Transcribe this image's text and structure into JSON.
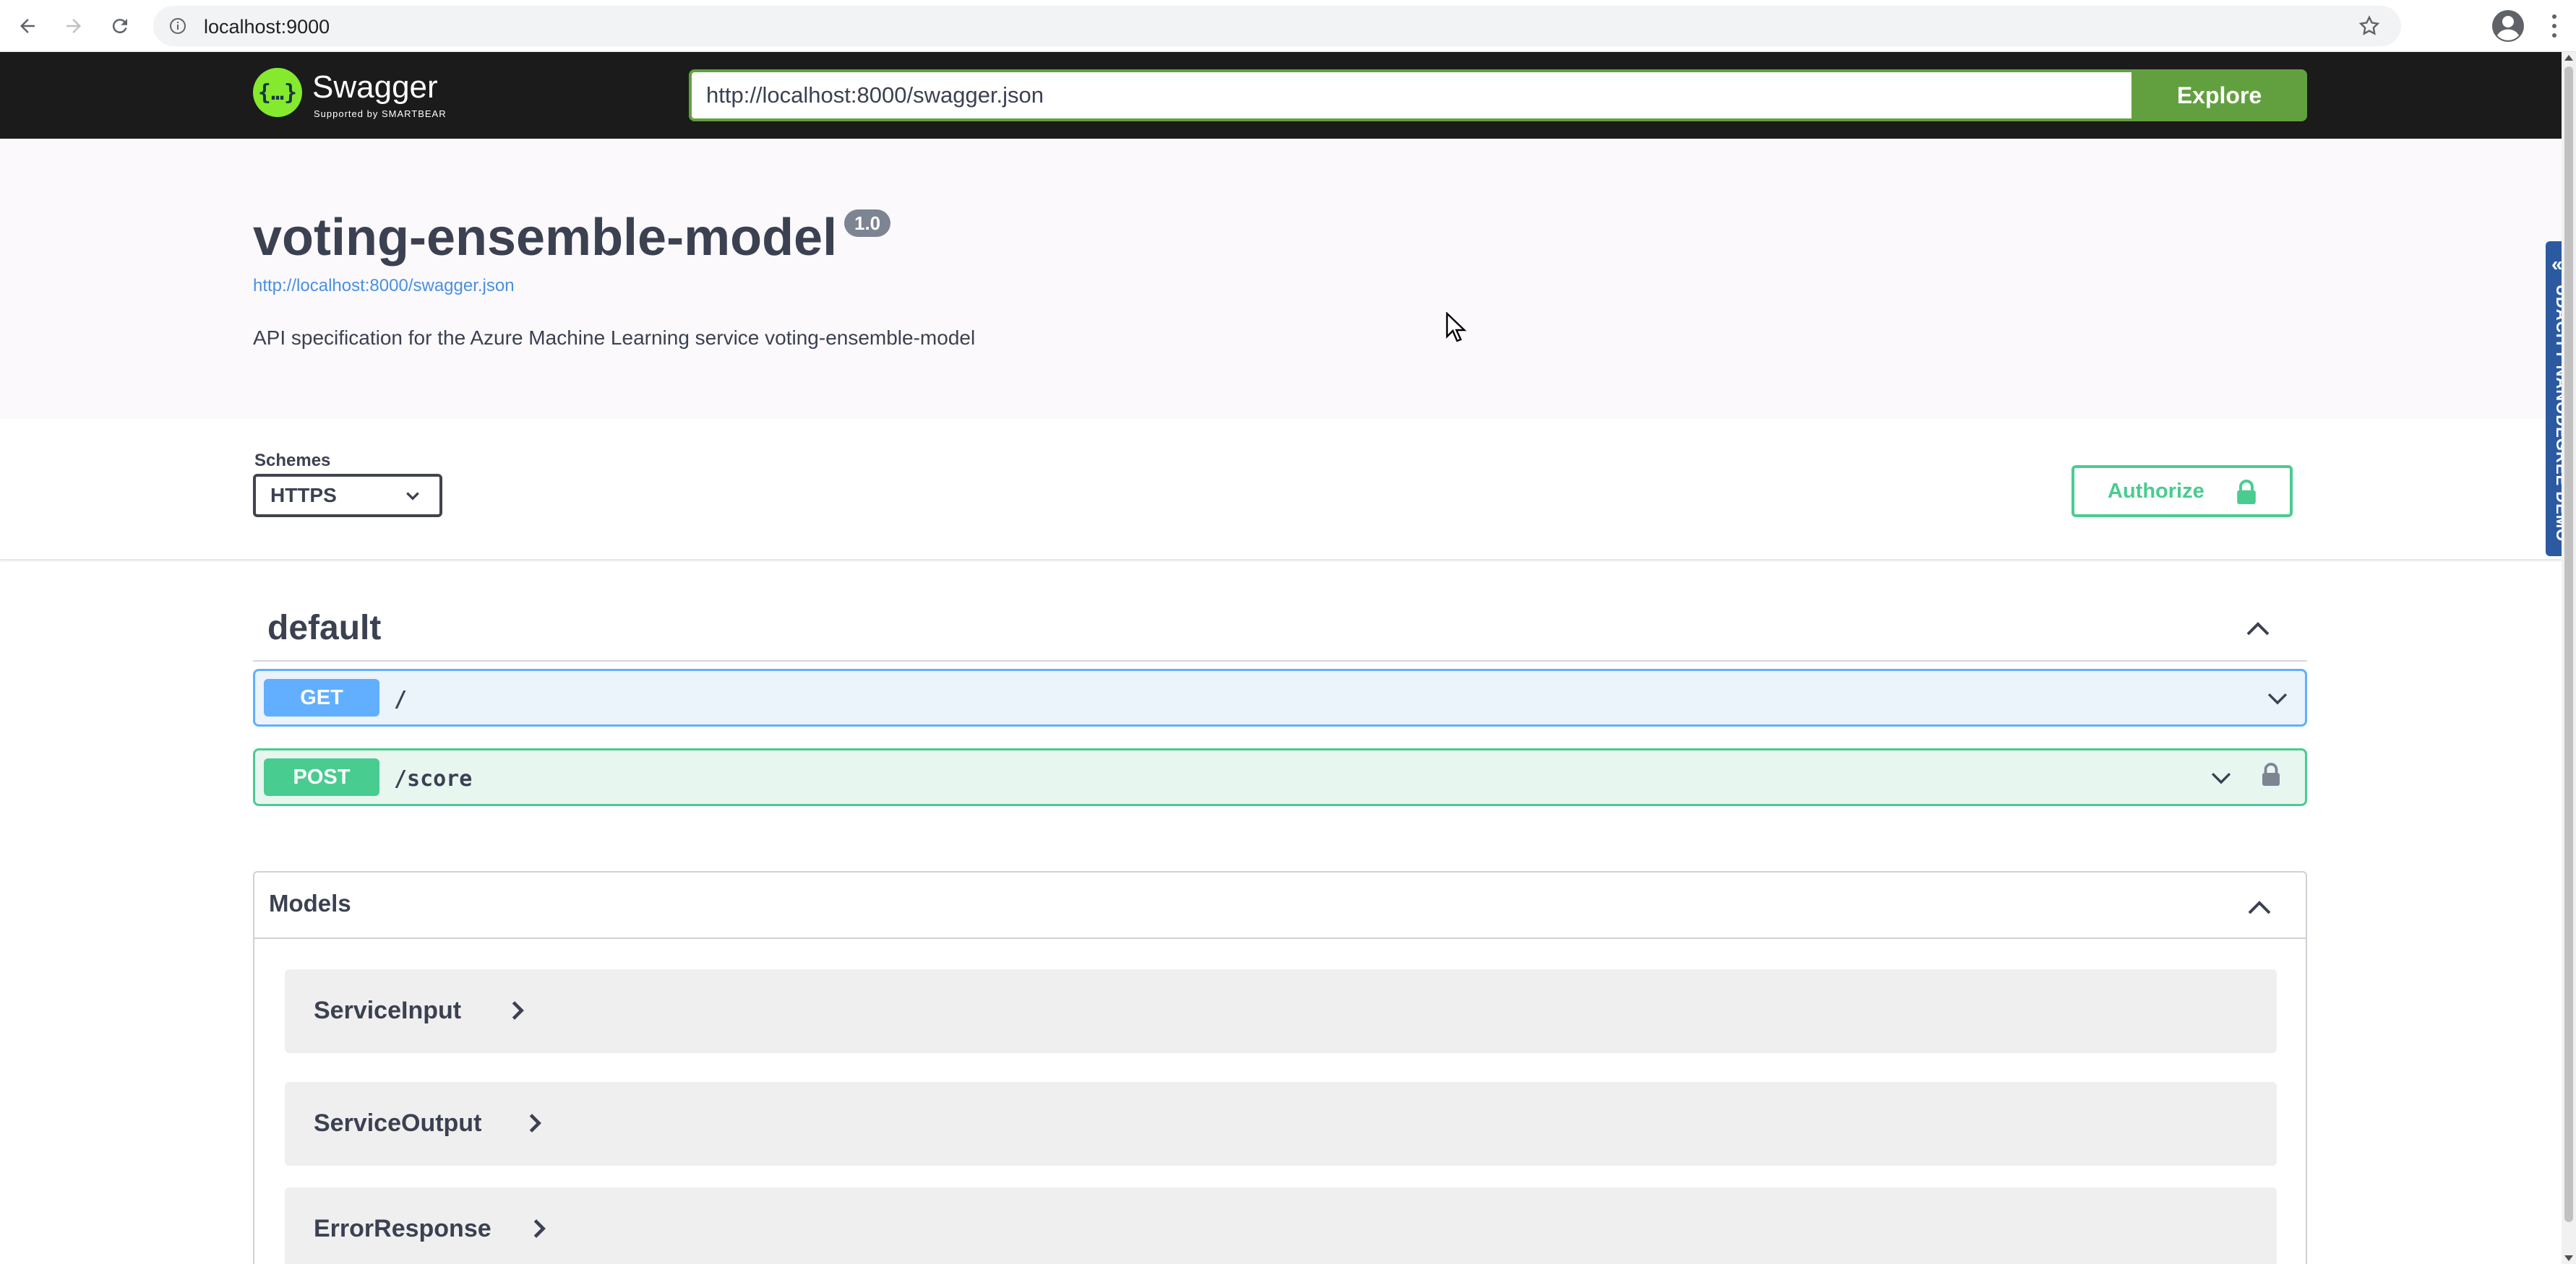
{
  "browser": {
    "url": "localhost:9000"
  },
  "topbar": {
    "logo_text": "Swagger",
    "logo_subtext": "Supported by SMARTBEAR",
    "spec_url_value": "http://localhost:8000/swagger.json",
    "explore_label": "Explore"
  },
  "info": {
    "title": "voting-ensemble-model",
    "version": "1.0",
    "spec_link": "http://localhost:8000/swagger.json",
    "description": "API specification for the Azure Machine Learning service voting-ensemble-model"
  },
  "schemes": {
    "label": "Schemes",
    "selected": "HTTPS",
    "authorize_label": "Authorize"
  },
  "side_tab": {
    "label": "UDACITY NANODEGREE DEMO"
  },
  "operations": {
    "tag": "default",
    "items": [
      {
        "method": "GET",
        "path": "/"
      },
      {
        "method": "POST",
        "path": "/score"
      }
    ]
  },
  "models": {
    "title": "Models",
    "items": [
      {
        "name": "ServiceInput"
      },
      {
        "name": "ServiceOutput"
      },
      {
        "name": "ErrorResponse"
      }
    ]
  },
  "colors": {
    "get": "#61affe",
    "post": "#49cc90",
    "explore": "#62a03f",
    "topbar": "#1b1b1b",
    "side_tab": "#2c5aa0"
  },
  "icons": [
    "back-arrow-icon",
    "forward-arrow-icon",
    "reload-icon",
    "info-icon",
    "star-icon",
    "profile-icon",
    "menu-icon",
    "lock-icon",
    "chevron-down-icon",
    "chevron-up-icon",
    "chevron-right-icon",
    "mouse-cursor-icon"
  ]
}
